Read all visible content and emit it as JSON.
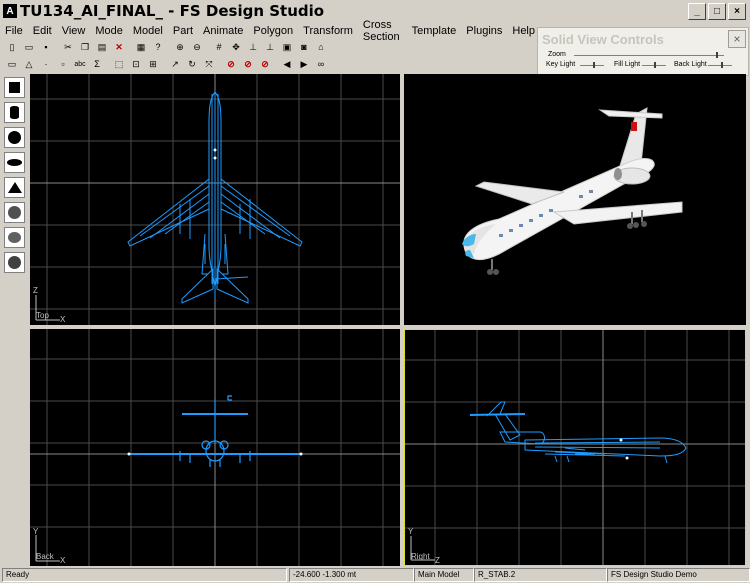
{
  "window": {
    "title": "TU134_AI_FINAL_ - FS Design Studio",
    "app_icon_glyph": "A",
    "buttons": {
      "minimize": "_",
      "maximize": "□",
      "close": "×"
    }
  },
  "menu": {
    "items": [
      "File",
      "Edit",
      "View",
      "Mode",
      "Model",
      "Part",
      "Animate",
      "Polygon",
      "Transform",
      "Cross Section",
      "Template",
      "Plugins",
      "Help"
    ]
  },
  "toolbar1": {
    "icons": [
      "new-icon",
      "open-icon",
      "save-icon",
      "cut-icon",
      "copy-icon",
      "paste-icon",
      "delete-icon",
      "undo-icon",
      "help-icon",
      "zoom-in-icon",
      "zoom-out-icon",
      "grid-icon",
      "move-icon",
      "pan-icon",
      "axis-icon",
      "render-icon",
      "camera-icon",
      "print-icon"
    ]
  },
  "toolbar2": {
    "icons": [
      "select-box-icon",
      "triangle-icon",
      "vertex-icon",
      "rect-icon",
      "abc-icon",
      "sigma-icon",
      "marquee-icon",
      "scale-icon",
      "lasso-icon",
      "arrow-icon",
      "rotate-icon",
      "mirror-icon",
      "no-rotate-icon",
      "no-scale-icon",
      "no-move-icon",
      "prev-icon",
      "next-icon",
      "binoculars-icon"
    ],
    "abc_label": "abc",
    "sigma_label": "Σ"
  },
  "solid_view_controls": {
    "title": "Solid View Controls",
    "close": "×",
    "zoom_label": "Zoom",
    "key_light_label": "Key Light",
    "fill_light_label": "Fill Light",
    "back_light_label": "Back Light",
    "zoom_level": 0.95,
    "key_light_level": 0.6,
    "fill_light_level": 0.55,
    "back_light_level": 0.6
  },
  "left_tools": {
    "icons": [
      "cube-icon",
      "cylinder-icon",
      "sphere-icon",
      "disc-icon",
      "cone-icon",
      "geosphere-icon",
      "torus-icon",
      "hemisphere-icon"
    ]
  },
  "viewports": {
    "top": {
      "label": "Top",
      "axis_v": "Z",
      "axis_h": "X"
    },
    "solid": {
      "label": ""
    },
    "back": {
      "label": "Back",
      "axis_v": "Y",
      "axis_h": "X"
    },
    "right": {
      "label": "Right",
      "axis_v": "Y",
      "axis_h": "Z"
    }
  },
  "colors": {
    "wire": "#1e9bff",
    "grid": "#4a4a4a",
    "active_border": "#e0e020",
    "aircraft_body": "#f4f4f4",
    "cockpit": "#4ab8e8"
  },
  "status": {
    "ready": "Ready",
    "coords": "-24.600   -1.300 mt",
    "model": "Main Model",
    "part": "R_STAB.2",
    "product": "FS Design Studio Demo"
  }
}
